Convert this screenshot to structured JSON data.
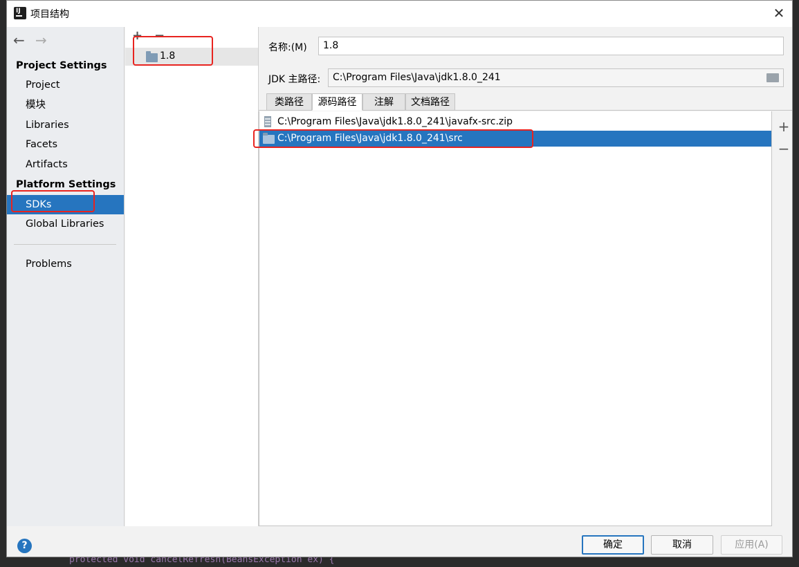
{
  "window": {
    "title": "项目结构",
    "close_glyph": "✕"
  },
  "nav": {
    "back_glyph": "←",
    "forward_glyph": "→",
    "project_settings_header": "Project Settings",
    "project_items": [
      "Project",
      "模块",
      "Libraries",
      "Facets",
      "Artifacts"
    ],
    "platform_settings_header": "Platform Settings",
    "platform_items": [
      "SDKs",
      "Global Libraries"
    ],
    "selected": "SDKs",
    "problems": "Problems"
  },
  "sdk_list": {
    "add_glyph": "+",
    "remove_glyph": "−",
    "items": [
      "1.8"
    ]
  },
  "details": {
    "name_label": "名称:(M)",
    "name_value": "1.8",
    "jdk_home_label": "JDK 主路径:",
    "jdk_home_value": "C:\\Program Files\\Java\\jdk1.8.0_241",
    "tabs": [
      "类路径",
      "源码路径",
      "注解",
      "文档路径"
    ],
    "selected_tab": "源码路径",
    "paths": [
      {
        "text": "C:\\Program Files\\Java\\jdk1.8.0_241\\javafx-src.zip",
        "icon": "archive-icon"
      },
      {
        "text": "C:\\Program Files\\Java\\jdk1.8.0_241\\src",
        "icon": "folder-icon"
      }
    ],
    "add_path_glyph": "+",
    "remove_path_glyph": "−"
  },
  "footer": {
    "help_glyph": "?",
    "ok_label": "确定",
    "cancel_label": "取消",
    "apply_label": "应用(A)"
  },
  "background": {
    "code_line": "protected void cancelRefresh(BeansException ex) {"
  },
  "colors": {
    "selection": "#2675bf",
    "annotation": "#e8231f"
  }
}
